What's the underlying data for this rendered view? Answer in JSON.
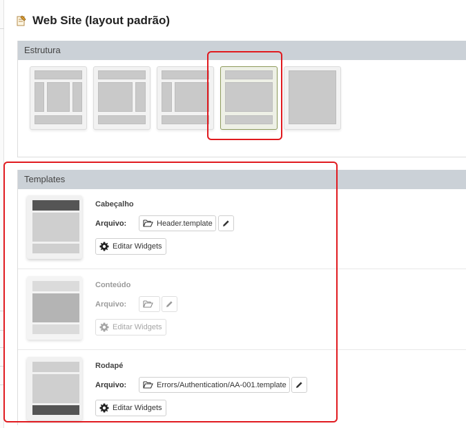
{
  "page": {
    "title": "Web Site (layout padrão)",
    "title_icon": "template-page-icon"
  },
  "estrutura": {
    "heading": "Estrutura",
    "layouts": [
      {
        "name": "three-column",
        "selected": false
      },
      {
        "name": "two-column-right-sidebar",
        "selected": false
      },
      {
        "name": "two-column-left-sidebar",
        "selected": false
      },
      {
        "name": "single-column",
        "selected": true
      },
      {
        "name": "blank",
        "selected": false
      }
    ]
  },
  "templates": {
    "heading": "Templates",
    "file_label": "Arquivo:",
    "widgets_label": "Editar Widgets",
    "items": [
      {
        "name": "Cabeçalho",
        "file": "Header.template",
        "enabled": true,
        "highlight": "top"
      },
      {
        "name": "Conteúdo",
        "file": "",
        "enabled": false,
        "highlight": "middle"
      },
      {
        "name": "Rodapé",
        "file": "Errors/Authentication/AA-001.template",
        "enabled": true,
        "highlight": "bottom"
      }
    ]
  },
  "colors": {
    "annotation": "#e0191e",
    "panel_header": "#cbd1d7",
    "selected_layout_border": "#8d9a5a"
  }
}
